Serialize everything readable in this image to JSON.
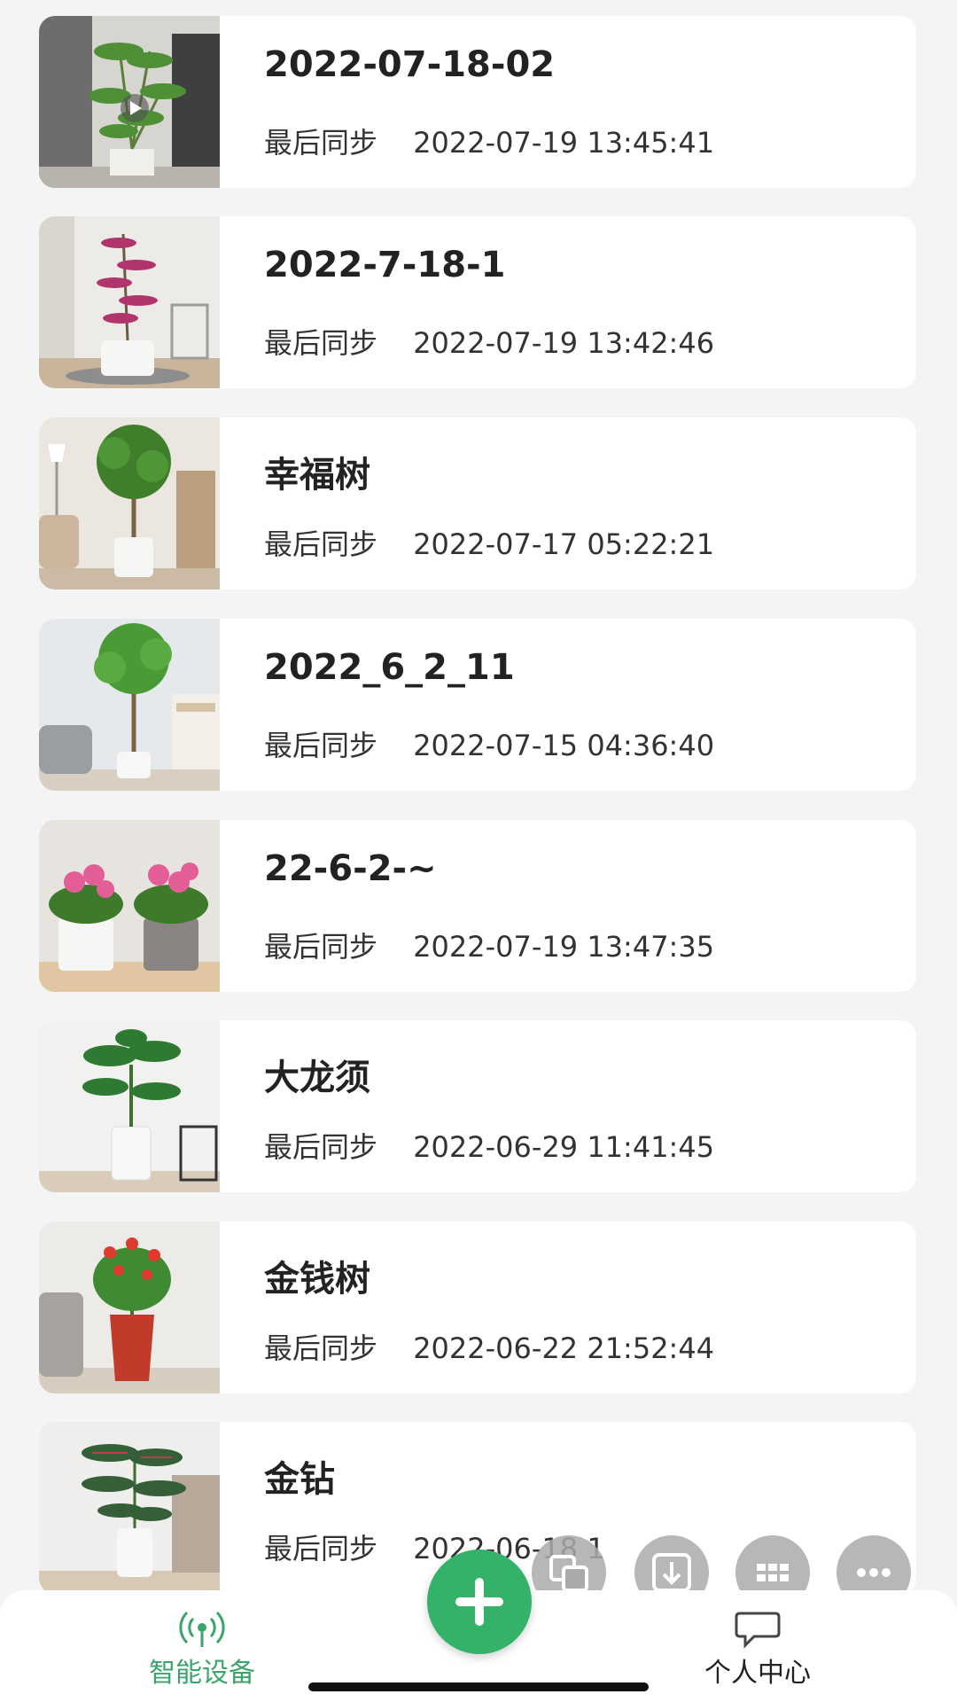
{
  "devices": [
    {
      "name": "2022-07-18-02",
      "sync_label": "最后同步",
      "sync_time": "2022-07-19 13:45:41",
      "thumb_icon": "plant-photo-icon"
    },
    {
      "name": "2022-7-18-1",
      "sync_label": "最后同步",
      "sync_time": "2022-07-19 13:42:46",
      "thumb_icon": "plant-photo-icon"
    },
    {
      "name": "幸福树",
      "sync_label": "最后同步",
      "sync_time": "2022-07-17 05:22:21",
      "thumb_icon": "plant-photo-icon"
    },
    {
      "name": "2022_6_2_11",
      "sync_label": "最后同步",
      "sync_time": "2022-07-15 04:36:40",
      "thumb_icon": "plant-photo-icon"
    },
    {
      "name": "22-6-2-~",
      "sync_label": "最后同步",
      "sync_time": "2022-07-19 13:47:35",
      "thumb_icon": "plant-photo-icon"
    },
    {
      "name": "大龙须",
      "sync_label": "最后同步",
      "sync_time": "2022-06-29 11:41:45",
      "thumb_icon": "plant-photo-icon"
    },
    {
      "name": "金钱树",
      "sync_label": "最后同步",
      "sync_time": "2022-06-22 21:52:44",
      "thumb_icon": "plant-photo-icon"
    },
    {
      "name": "金钻",
      "sync_label": "最后同步",
      "sync_time": "2022-06-18 1",
      "thumb_icon": "plant-photo-icon"
    }
  ],
  "tabbar": {
    "devices_label": "智能设备",
    "profile_label": "个人中心",
    "devices_icon": "signal-tower-icon",
    "profile_icon": "chat-bubble-icon",
    "active_color": "#3aa56b"
  },
  "fab": {
    "icon": "plus-icon",
    "color": "#34b26a"
  },
  "floating_tools": [
    "translate-icon",
    "download-icon",
    "grid-icon",
    "more-icon"
  ]
}
